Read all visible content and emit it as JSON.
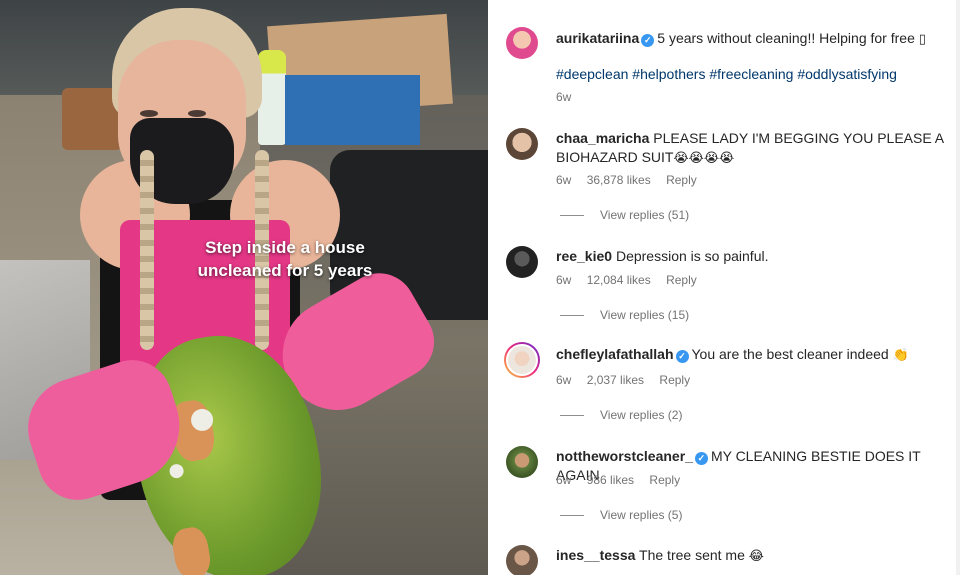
{
  "video": {
    "overlay_line1": "Step inside a house",
    "overlay_line2": "uncleaned for 5 years"
  },
  "post": {
    "username": "aurikatariina",
    "verified": true,
    "caption": "5 years without cleaning!! Helping for free",
    "caption_emoji": "▯",
    "hashtags": [
      "#deepclean",
      "#helpothers",
      "#freecleaning",
      "#oddlysatisfying"
    ],
    "time": "6w"
  },
  "comments": [
    {
      "username": "chaa_maricha",
      "verified": false,
      "text": "PLEASE LADY I'M BEGGING YOU PLEASE A BIOHAZARD SUIT",
      "emoji": "😭😭😭😭",
      "time": "6w",
      "likes": "36,878 likes",
      "reply_label": "Reply",
      "view_replies": "View replies (51)"
    },
    {
      "username": "ree_kie0",
      "verified": false,
      "text": "Depression is so painful.",
      "emoji": "",
      "time": "6w",
      "likes": "12,084 likes",
      "reply_label": "Reply",
      "view_replies": "View replies (15)"
    },
    {
      "username": "chefleylafathallah",
      "verified": true,
      "text": "You are the best cleaner indeed",
      "emoji": "👏",
      "time": "6w",
      "likes": "2,037 likes",
      "reply_label": "Reply",
      "view_replies": "View replies (2)"
    },
    {
      "username": "nottheworstcleaner_",
      "verified": true,
      "text": "MY CLEANING BESTIE DOES IT AGAIN",
      "emoji": "",
      "time": "6w",
      "likes": "986 likes",
      "reply_label": "Reply",
      "view_replies": "View replies (5)"
    },
    {
      "username": "ines__tessa",
      "verified": false,
      "text": "The tree sent me",
      "emoji": "😂",
      "time": "",
      "likes": "",
      "reply_label": "",
      "view_replies": ""
    }
  ],
  "colors": {
    "hashtag": "#00376b",
    "meta_gray": "#737373",
    "verified_blue": "#3897f0",
    "apron_pink": "#e43786"
  }
}
